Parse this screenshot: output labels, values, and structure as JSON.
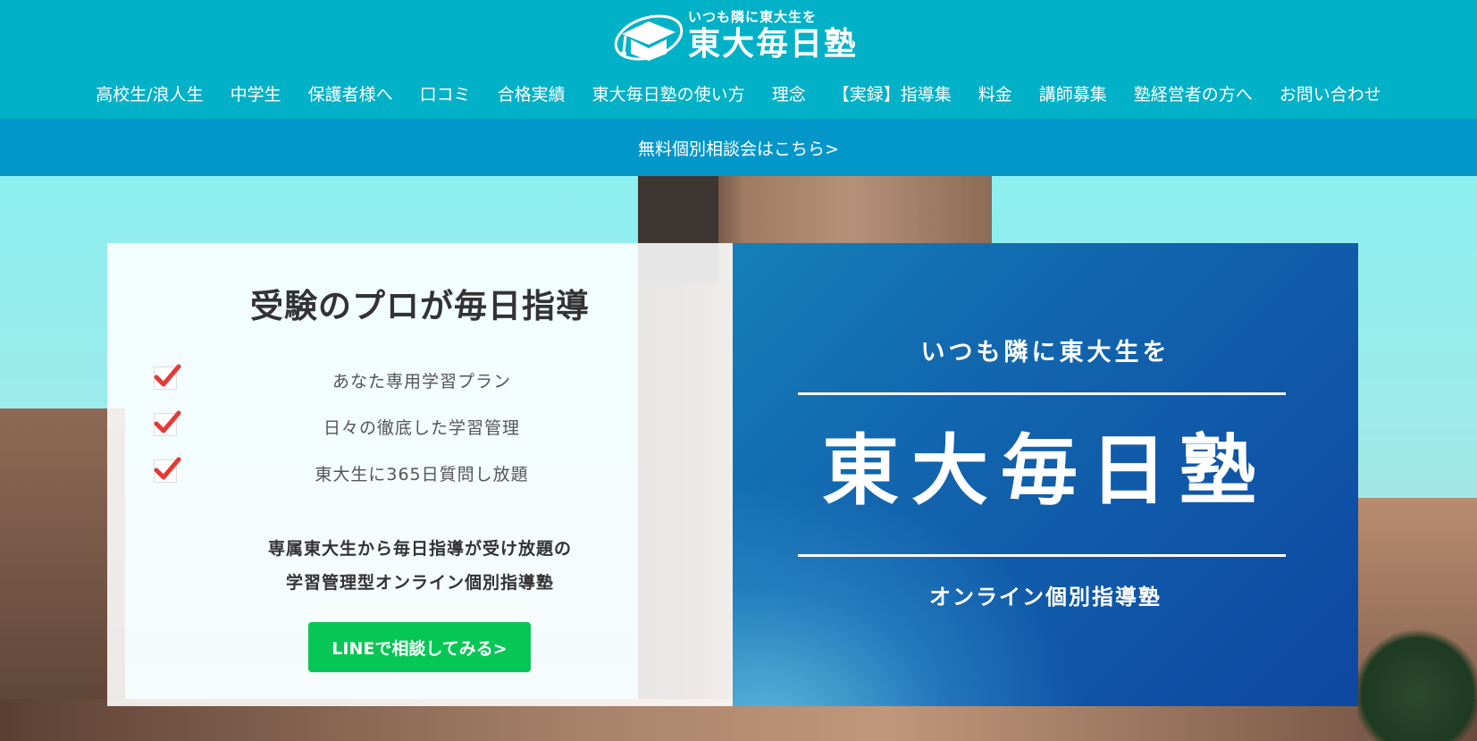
{
  "header": {
    "logo_tagline": "いつも隣に東大生を",
    "logo_name": "東大毎日塾",
    "nav": [
      "高校生/浪人生",
      "中学生",
      "保護者様へ",
      "口コミ",
      "合格実績",
      "東大毎日塾の使い方",
      "理念",
      "【実録】指導集",
      "料金",
      "講師募集",
      "塾経営者の方へ",
      "お問い合わせ"
    ]
  },
  "cta_bar": {
    "label": "無料個別相談会はこちら>"
  },
  "hero": {
    "title": "受験のプロが毎日指導",
    "features": [
      "あなた専用学習プラン",
      "日々の徹底した学習管理",
      "東大生に365日質問し放題"
    ],
    "description_line1": "専属東大生から毎日指導が受け放題の",
    "description_line2": "学習管理型オンライン個別指導塾",
    "line_button": "LINEで相談してみる>",
    "card_tagline": "いつも隣に東大生を",
    "card_name": "東大毎日塾",
    "card_subtitle": "オンライン個別指導塾"
  },
  "colors": {
    "header_bg": "#01b1c7",
    "cta_bar_bg": "#0397c9",
    "line_green": "#06c755",
    "check_red": "#e53935",
    "card_blue": "#0d47a1"
  }
}
